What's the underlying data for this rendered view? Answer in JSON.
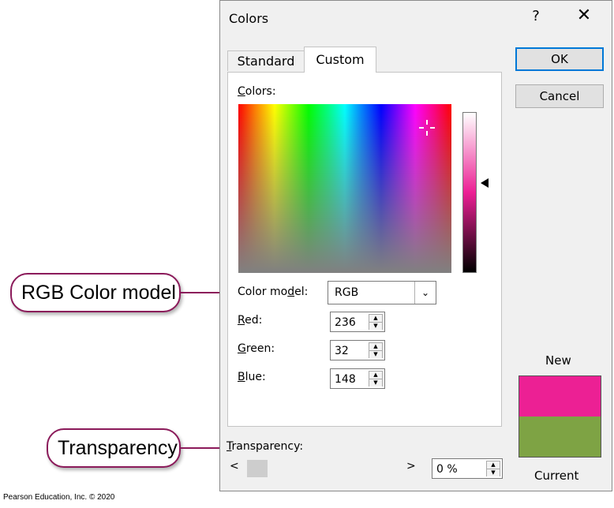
{
  "dialog": {
    "title": "Colors",
    "help_label": "?",
    "close_label": "✕"
  },
  "tabs": {
    "standard": "Standard",
    "custom": "Custom"
  },
  "custom": {
    "colors_label_u": "C",
    "colors_label_rest": "olors:",
    "color_model_label_pre": "Color mo",
    "color_model_label_u": "d",
    "color_model_label_post": "el:",
    "color_model_value": "RGB",
    "red_label_u": "R",
    "red_label_rest": "ed:",
    "red_value": "236",
    "green_label_u": "G",
    "green_label_rest": "reen:",
    "green_value": "32",
    "blue_label_u": "B",
    "blue_label_rest": "lue:",
    "blue_value": "148"
  },
  "buttons": {
    "ok": "OK",
    "cancel": "Cancel"
  },
  "preview": {
    "new_label": "New",
    "current_label": "Current",
    "new_color": "#ec2094",
    "current_color": "#7ea344"
  },
  "transparency": {
    "label_u": "T",
    "label_rest": "ransparency:",
    "scroll_left": "<",
    "scroll_right": ">",
    "value": "0 %"
  },
  "callouts": {
    "rgb": "RGB Color model",
    "transparency": "Transparency"
  },
  "credit": "Pearson Education, Inc. © 2020"
}
